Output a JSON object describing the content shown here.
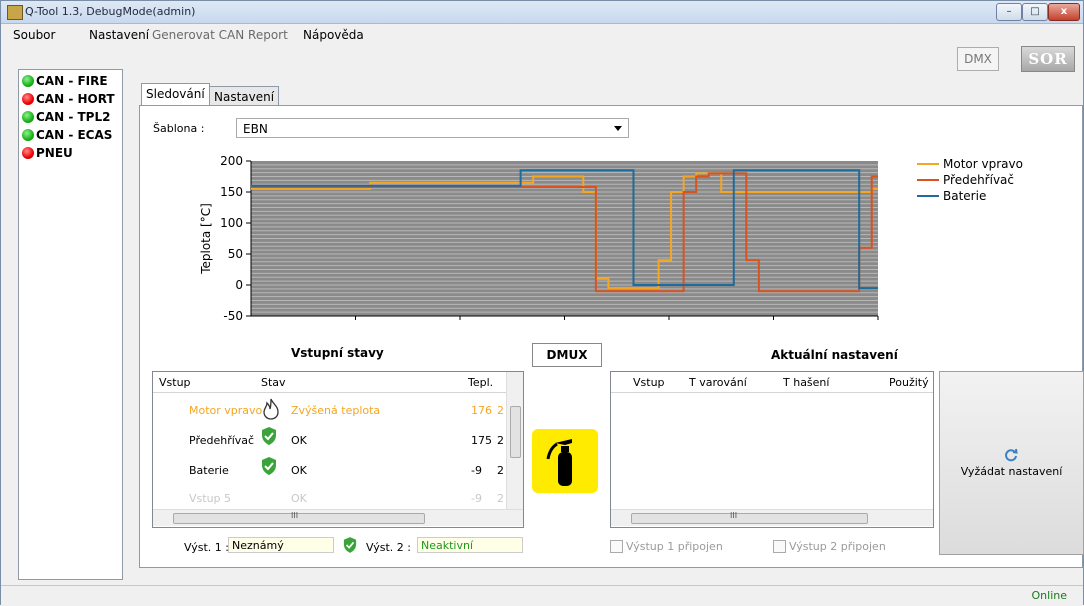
{
  "window": {
    "title": "Q-Tool 1.3, DebugMode(admin)",
    "minimize": "–",
    "maximize": "□",
    "close": "x"
  },
  "menu": {
    "items": [
      "Soubor",
      "Nastavení",
      "Generovat CAN Report",
      "Nápověda"
    ]
  },
  "toolbar": {
    "dmx": "DMX",
    "logo": "SOR"
  },
  "buses": [
    {
      "label": "CAN - FIRE",
      "status": "green"
    },
    {
      "label": "CAN - HORT",
      "status": "red"
    },
    {
      "label": "CAN - TPL2",
      "status": "green"
    },
    {
      "label": "CAN - ECAS",
      "status": "green"
    },
    {
      "label": "PNEU",
      "status": "red"
    }
  ],
  "tabs": [
    "Sledování",
    "Nastavení"
  ],
  "template": {
    "label": "Šablona :",
    "value": "EBN"
  },
  "chart_data": {
    "type": "line",
    "ylabel": "Teplota [°C]",
    "ylim": [
      -50,
      200
    ],
    "yticks": [
      200,
      150,
      100,
      50,
      0,
      -50
    ],
    "x": [
      0,
      2,
      4,
      6,
      8,
      10,
      12,
      14,
      16,
      18,
      20,
      22,
      24,
      26,
      28,
      30,
      32,
      34,
      36,
      38,
      40,
      42,
      44,
      46,
      48,
      50,
      52,
      54,
      56,
      58,
      60,
      62,
      64,
      66,
      68,
      70,
      72,
      74,
      76,
      78,
      80,
      82,
      84,
      86,
      88,
      90,
      92,
      94,
      96,
      98,
      100
    ],
    "series": [
      {
        "name": "Motor vpravo",
        "color": "#f5a623",
        "values": [
          155,
          155,
          155,
          155,
          155,
          155,
          155,
          155,
          155,
          155,
          165,
          165,
          165,
          165,
          165,
          165,
          165,
          165,
          165,
          165,
          165,
          165,
          165,
          175,
          175,
          175,
          175,
          150,
          10,
          -5,
          -5,
          -5,
          -5,
          40,
          150,
          175,
          180,
          180,
          150,
          150,
          150,
          150,
          150,
          150,
          150,
          150,
          150,
          150,
          150,
          150,
          155
        ]
      },
      {
        "name": "Předehřívač",
        "color": "#d9531e",
        "values": [
          158,
          158,
          158,
          158,
          158,
          158,
          158,
          158,
          158,
          158,
          158,
          158,
          158,
          158,
          158,
          158,
          158,
          158,
          158,
          158,
          158,
          158,
          158,
          158,
          158,
          158,
          158,
          158,
          -10,
          -10,
          -10,
          -10,
          -10,
          -10,
          -10,
          150,
          175,
          180,
          180,
          180,
          40,
          -10,
          -10,
          -10,
          -10,
          -10,
          -10,
          -10,
          -10,
          60,
          175
        ]
      },
      {
        "name": "Baterie",
        "color": "#1f6b9c",
        "values": [
          160,
          160,
          160,
          160,
          160,
          160,
          160,
          160,
          160,
          160,
          160,
          160,
          160,
          160,
          160,
          160,
          160,
          160,
          160,
          160,
          160,
          160,
          185,
          185,
          185,
          185,
          185,
          185,
          185,
          185,
          185,
          0,
          0,
          0,
          0,
          0,
          0,
          0,
          0,
          185,
          185,
          185,
          185,
          185,
          185,
          185,
          185,
          185,
          185,
          -5,
          -5
        ]
      }
    ],
    "legend": "right",
    "grid": true
  },
  "inputs": {
    "title": "Vstupní stavy",
    "headers": [
      "Vstup",
      "Stav",
      "Tepl."
    ],
    "rows": [
      {
        "name": "Motor vpravo",
        "state": "Zvýšená teplota",
        "temp": "176",
        "extra": "2"
      },
      {
        "name": "Předehřívač",
        "state": "OK",
        "temp": "175",
        "extra": "2"
      },
      {
        "name": "Baterie",
        "state": "OK",
        "temp": "-9",
        "extra": "2"
      },
      {
        "name": "Vstup 5",
        "state": "OK",
        "temp": "-9",
        "extra": "2"
      }
    ],
    "scroll_marker": "III"
  },
  "dmux": {
    "label": "DMUX"
  },
  "current": {
    "title": "Aktuální nastavení",
    "headers": [
      "Vstup",
      "T varování",
      "T hašení",
      "Použitý"
    ],
    "scroll_marker": "III"
  },
  "outputs": {
    "out1_label": "Výst. 1 :",
    "out1_value": "Neznámý",
    "out2_label": "Výst. 2 :",
    "out2_value": "Neaktivní",
    "chk1": "Výstup 1 připojen",
    "chk2": "Výstup 2 připojen"
  },
  "request_button": {
    "label": "Vyžádat nastavení"
  },
  "status": {
    "text": "Online"
  }
}
